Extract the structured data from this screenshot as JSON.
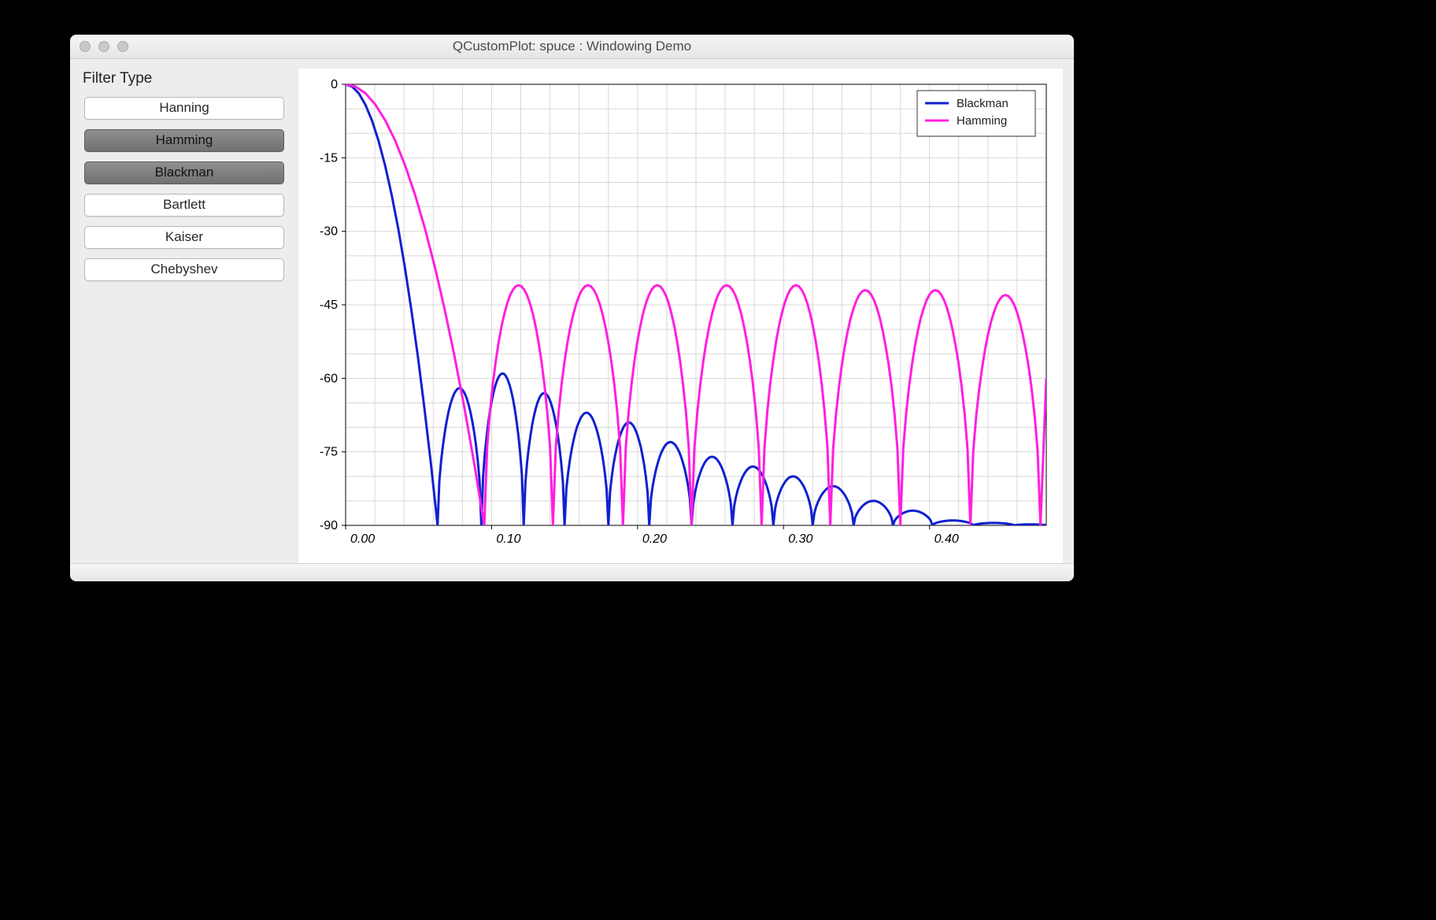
{
  "window": {
    "title": "QCustomPlot: spuce : Windowing Demo"
  },
  "sidebar": {
    "section_label": "Filter Type",
    "buttons": [
      {
        "label": "Hanning",
        "selected": false
      },
      {
        "label": "Hamming",
        "selected": true
      },
      {
        "label": "Blackman",
        "selected": true
      },
      {
        "label": "Bartlett",
        "selected": false
      },
      {
        "label": "Kaiser",
        "selected": false
      },
      {
        "label": "Chebyshev",
        "selected": false
      }
    ]
  },
  "chart_data": {
    "type": "line",
    "x_range": [
      0.0,
      0.48
    ],
    "y_range": [
      -90,
      0
    ],
    "x_ticks": [
      0.0,
      0.1,
      0.2,
      0.3,
      0.4
    ],
    "y_ticks": [
      0,
      -15,
      -30,
      -45,
      -60,
      -75,
      -90
    ],
    "x_tick_labels": [
      "0.00",
      "0.10",
      "0.20",
      "0.30",
      "0.40"
    ],
    "y_tick_labels": [
      "0",
      "-15",
      "-30",
      "-45",
      "-60",
      "-75",
      "-90"
    ],
    "grid": {
      "x_step": 0.02,
      "y_step": 5
    },
    "legend": {
      "position": "top-right",
      "entries": [
        "Blackman",
        "Hamming"
      ]
    },
    "series": [
      {
        "name": "Blackman",
        "color": "#1020d0",
        "notes": "Main lobe from 0 dB falling; first null near x≈0.063; sidelobe peaks (dB) decaying roughly -59,-59,-63,-67,-69,-71,-74,-77,-79,-81,-83,-85,-87,-89 at evenly-spaced lobes to x≈0.48.",
        "main_lobe": {
          "start_x": 0.0,
          "start_y": 0.0,
          "null_x": 0.063
        },
        "lobes": [
          {
            "null_left": 0.063,
            "peak_x": 0.078,
            "peak_y": -62,
            "null_right": 0.093
          },
          {
            "null_left": 0.093,
            "peak_x": 0.108,
            "peak_y": -59,
            "null_right": 0.122
          },
          {
            "null_left": 0.122,
            "peak_x": 0.137,
            "peak_y": -63,
            "null_right": 0.15
          },
          {
            "null_left": 0.15,
            "peak_x": 0.165,
            "peak_y": -67,
            "null_right": 0.18
          },
          {
            "null_left": 0.18,
            "peak_x": 0.193,
            "peak_y": -69,
            "null_right": 0.208
          },
          {
            "null_left": 0.208,
            "peak_x": 0.222,
            "peak_y": -73,
            "null_right": 0.237
          },
          {
            "null_left": 0.237,
            "peak_x": 0.25,
            "peak_y": -76,
            "null_right": 0.265
          },
          {
            "null_left": 0.265,
            "peak_x": 0.278,
            "peak_y": -78,
            "null_right": 0.293
          },
          {
            "null_left": 0.293,
            "peak_x": 0.305,
            "peak_y": -80,
            "null_right": 0.32
          },
          {
            "null_left": 0.32,
            "peak_x": 0.333,
            "peak_y": -82,
            "null_right": 0.348
          },
          {
            "null_left": 0.348,
            "peak_x": 0.36,
            "peak_y": -85,
            "null_right": 0.375
          },
          {
            "null_left": 0.375,
            "peak_x": 0.388,
            "peak_y": -87,
            "null_right": 0.402
          },
          {
            "null_left": 0.402,
            "peak_x": 0.415,
            "peak_y": -89,
            "null_right": 0.43
          },
          {
            "null_left": 0.43,
            "peak_x": 0.443,
            "peak_y": -89.5,
            "null_right": 0.458
          },
          {
            "null_left": 0.458,
            "peak_x": 0.47,
            "peak_y": -89.8,
            "null_right": 0.48
          }
        ]
      },
      {
        "name": "Hamming",
        "color": "#ff1fe0",
        "notes": "Main lobe from 0 dB; first null near x≈0.095; sidelobe peaks roughly constant around -41 to -43 dB across x∈[0.1,0.48].",
        "main_lobe": {
          "start_x": 0.0,
          "start_y": 0.0,
          "null_x": 0.095
        },
        "lobes": [
          {
            "null_left": 0.095,
            "peak_x": 0.118,
            "peak_y": -41,
            "null_right": 0.142
          },
          {
            "null_left": 0.142,
            "peak_x": 0.165,
            "peak_y": -41,
            "null_right": 0.19
          },
          {
            "null_left": 0.19,
            "peak_x": 0.213,
            "peak_y": -41,
            "null_right": 0.237
          },
          {
            "null_left": 0.237,
            "peak_x": 0.26,
            "peak_y": -41,
            "null_right": 0.285
          },
          {
            "null_left": 0.285,
            "peak_x": 0.308,
            "peak_y": -41,
            "null_right": 0.332
          },
          {
            "null_left": 0.332,
            "peak_x": 0.355,
            "peak_y": -42,
            "null_right": 0.38
          },
          {
            "null_left": 0.38,
            "peak_x": 0.403,
            "peak_y": -42,
            "null_right": 0.428
          },
          {
            "null_left": 0.428,
            "peak_x": 0.452,
            "peak_y": -43,
            "null_right": 0.476
          }
        ],
        "endpoint": {
          "x": 0.48,
          "y": -60
        }
      }
    ]
  }
}
